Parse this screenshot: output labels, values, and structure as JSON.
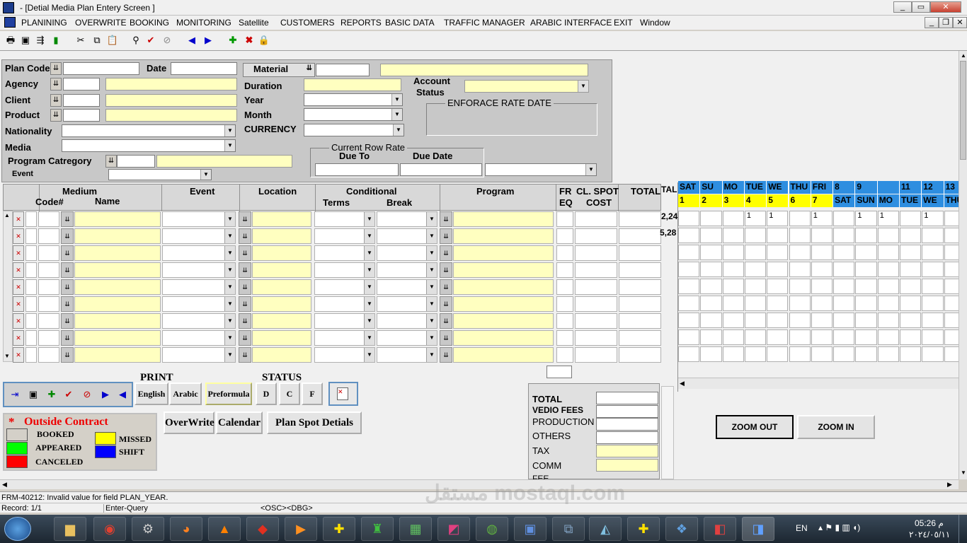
{
  "window": {
    "title": "- [Detial Media Plan Entery Screen ]",
    "icon": "oracle-forms-icon"
  },
  "menu": [
    "PLANINING",
    "OVERWRITE",
    "BOOKING",
    "MONITORING",
    "Satellite",
    "CUSTOMERS",
    "REPORTS",
    "BASIC DATA",
    "TRAFFIC  MANAGER",
    "ARABIC INTERFACE",
    "EXIT",
    "Window"
  ],
  "header_form": {
    "plan_code": "Plan Code",
    "date": "Date",
    "agency": "Agency",
    "client": "Client",
    "product": "Product",
    "nationality": "Nationality",
    "media": "Media",
    "program_category": "Program  Catregory",
    "event": "Event",
    "material": "Material",
    "duration": "Duration",
    "year": "Year",
    "month": "Month",
    "currency": "CURRENCY",
    "account_status_1": "Account",
    "account_status_2": "Status",
    "enforce_rate_date": "ENFORACE  RATE DATE",
    "current_row_rate": "Current Row Rate",
    "due_to": "Due To",
    "due_date": "Due Date"
  },
  "grid": {
    "medium": "Medium",
    "code": "Code#",
    "name": "Name",
    "event": "Event",
    "location": "Location",
    "conditional": "Conditional",
    "terms": "Terms",
    "break": "Break",
    "program": "Program",
    "freq_1": "FR",
    "freq_2": "EQ",
    "cl_spot_1": "CL. SPOT",
    "cl_spot_2": "COST",
    "total": "TOTAL",
    "total_partial": "TAL",
    "total_values": [
      "2,24",
      "5,28"
    ]
  },
  "calendar": {
    "days": [
      "SAT",
      "SU",
      "MO",
      "TUE",
      "WE",
      "THU",
      "FRI",
      "8",
      "9",
      "",
      "11",
      "12",
      "13"
    ],
    "dates": [
      "1",
      "2",
      "3",
      "4",
      "5",
      "6",
      "7",
      "SAT",
      "SUN",
      "MO",
      "TUE",
      "WE",
      "THU"
    ],
    "row1_marks": [
      "",
      "",
      "",
      "1",
      "1",
      "",
      "1",
      "",
      "1",
      "1",
      "",
      "1",
      ""
    ]
  },
  "print": {
    "title": "PRINT",
    "english": "English",
    "arabic": "Arabic",
    "preformula": "Preformula"
  },
  "status": {
    "title": "STATUS",
    "d": "D",
    "c": "C",
    "f": "F"
  },
  "legend": {
    "star": "*",
    "title": "Outside Contract",
    "booked": "BOOKED",
    "appeared": "APPEARED",
    "canceled": "CANCELED",
    "missed": "MISSED",
    "shift": "SHIFT",
    "colors": {
      "booked": "#d4d0c8",
      "appeared": "#00ff00",
      "canceled": "#ff0000",
      "missed": "#ffff00",
      "shift": "#0000ff"
    }
  },
  "actions": {
    "overwrite": "OverWrite",
    "calendar": "Calendar",
    "plan_spot": "Plan Spot Detials"
  },
  "totals": {
    "total": "TOTAL",
    "vedio": "VEDIO FEES",
    "production": "PRODUCTION",
    "others": "OTHERS",
    "tax": "TAX",
    "comm": "COMM",
    "fee": "FEE"
  },
  "zoom": {
    "out": "ZOOM OUT",
    "in": "ZOOM IN"
  },
  "status_bar": {
    "message": "FRM-40212: Invalid value for field PLAN_YEAR.",
    "record": "Record: 1/1",
    "mode": "Enter-Query",
    "osc": "<OSC>",
    "dbg": "<DBG>"
  },
  "taskbar": {
    "lang": "EN",
    "time": "05:26 م",
    "date": "٢٠٢٤/٠٥/١١"
  },
  "watermark": "مستقل mostaql.com"
}
